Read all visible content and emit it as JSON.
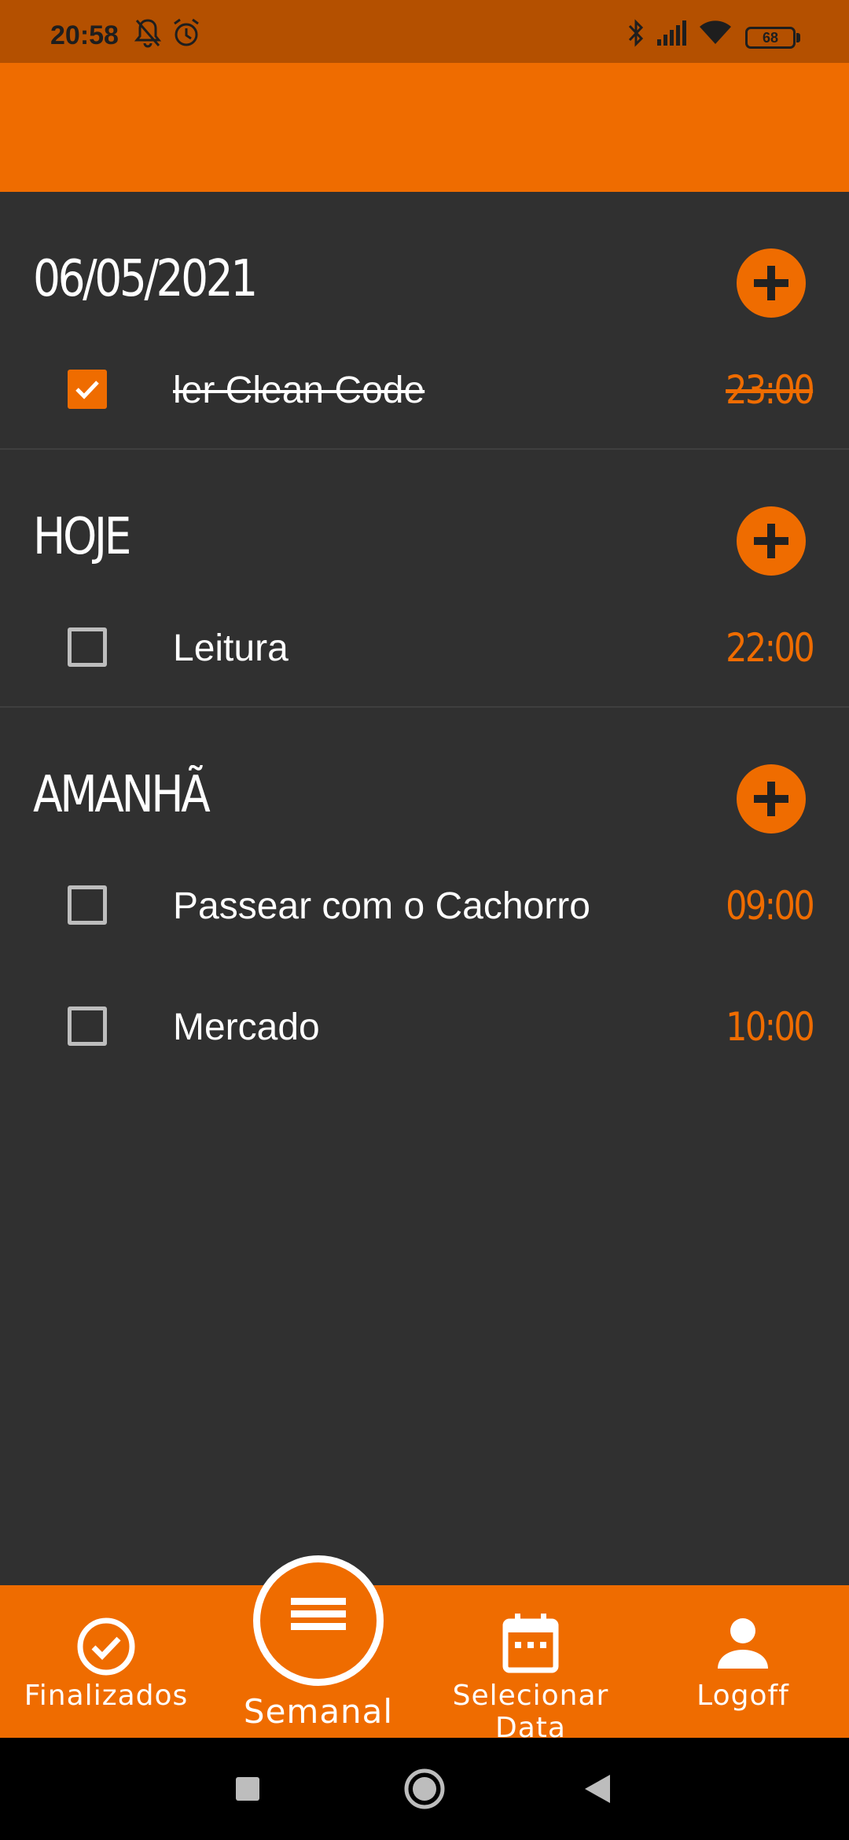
{
  "status_bar": {
    "time": "20:58",
    "battery": "68",
    "icons": [
      "bell-off-icon",
      "alarm-icon",
      "bluetooth-icon",
      "signal-icon",
      "wifi-icon",
      "battery-icon"
    ]
  },
  "colors": {
    "accent": "#ef6c00",
    "status_bar": "#b45000",
    "background": "#303030"
  },
  "sections": [
    {
      "title": "06/05/2021",
      "tasks": [
        {
          "label": "ler Clean Code",
          "time": "23:00",
          "done": true
        }
      ]
    },
    {
      "title": "HOJE",
      "tasks": [
        {
          "label": "Leitura",
          "time": "22:00",
          "done": false
        }
      ]
    },
    {
      "title": "AMANHÃ",
      "tasks": [
        {
          "label": "Passear com o Cachorro",
          "time": "09:00",
          "done": false
        },
        {
          "label": "Mercado",
          "time": "10:00",
          "done": false
        }
      ]
    }
  ],
  "bottom_nav": {
    "finalizados": "Finalizados",
    "semanal": "Semanal",
    "selecionar_data": "Selecionar Data",
    "logoff": "Logoff"
  }
}
